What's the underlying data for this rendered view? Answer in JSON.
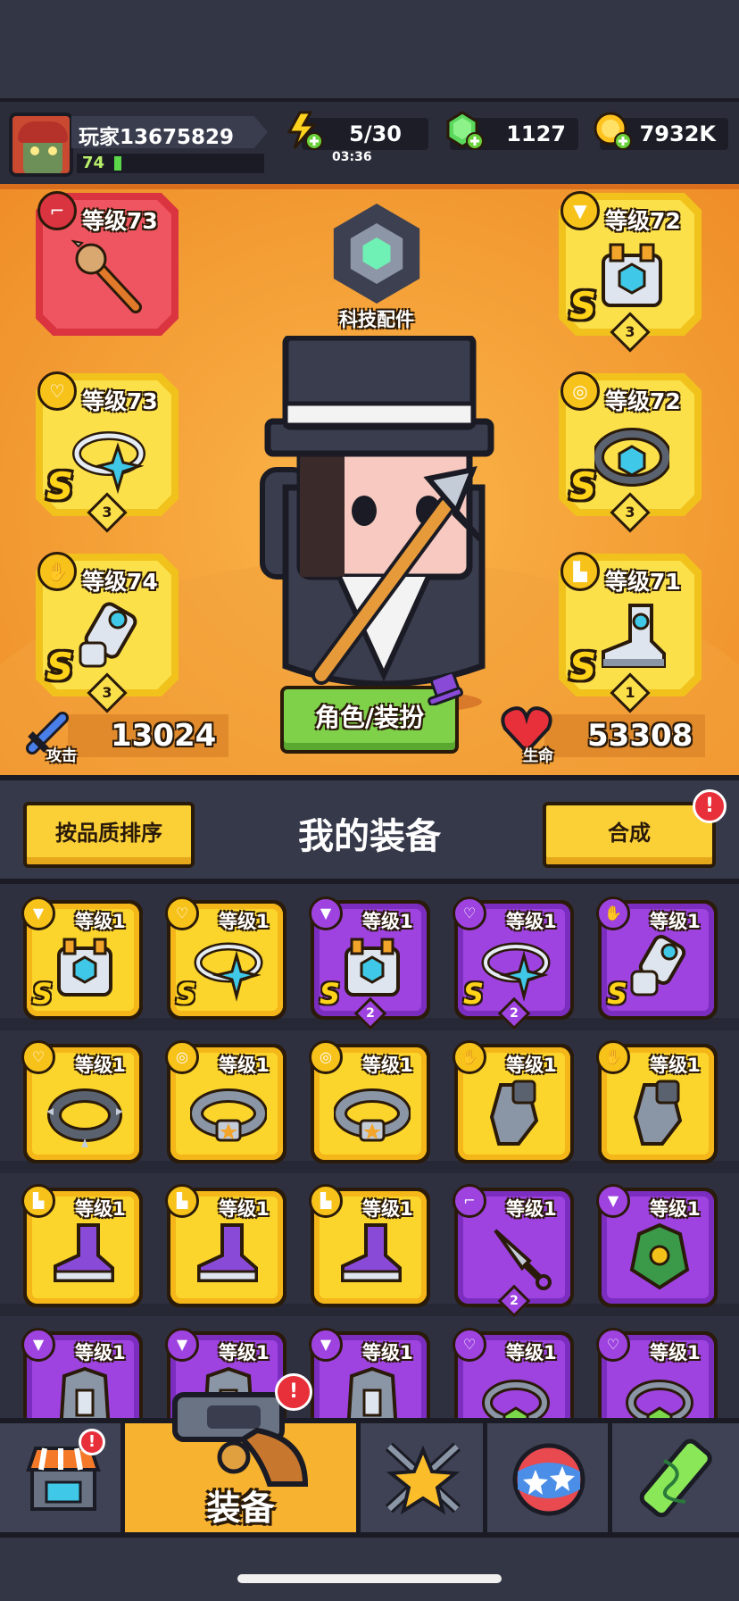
{
  "player": {
    "name": "玩家13675829",
    "level": "74",
    "xp_fraction": 0.05
  },
  "resources": {
    "energy": "5/30",
    "energy_timer": "03:36",
    "gems": "1127",
    "coins": "7932K"
  },
  "tech": {
    "label": "科技配件"
  },
  "equipped": {
    "weapon": {
      "level": "等级73",
      "slot_icon": "gun-icon",
      "item": "spiked-club"
    },
    "armor": {
      "level": "等级72",
      "slot_icon": "shirt-icon",
      "grade": "S",
      "stars": "3",
      "item": "mech-armor"
    },
    "necklace": {
      "level": "等级73",
      "slot_icon": "necklace-icon",
      "grade": "S",
      "stars": "3",
      "item": "star-ring"
    },
    "belt": {
      "level": "等级72",
      "slot_icon": "belt-icon",
      "grade": "S",
      "stars": "3",
      "item": "hex-belt"
    },
    "gloves": {
      "level": "等级74",
      "slot_icon": "glove-icon",
      "grade": "S",
      "stars": "3",
      "item": "mech-gauntlet"
    },
    "boots": {
      "level": "等级71",
      "slot_icon": "boot-icon",
      "grade": "S",
      "stars": "1",
      "item": "mech-boot"
    }
  },
  "stats": {
    "attack_label": "攻击",
    "attack": "13024",
    "hp_label": "生命",
    "hp": "53308"
  },
  "role_button": "角色/装扮",
  "section": {
    "sort_button": "按品质排序",
    "title": "我的装备",
    "merge_button": "合成",
    "merge_alert": "!"
  },
  "inventory": [
    {
      "level": "等级1",
      "rarity": "yellow",
      "grade": "S",
      "stars": "",
      "slot_icon": "shirt-icon",
      "item": "mech-armor"
    },
    {
      "level": "等级1",
      "rarity": "yellow",
      "grade": "S",
      "stars": "",
      "slot_icon": "necklace-icon",
      "item": "star-ring"
    },
    {
      "level": "等级1",
      "rarity": "purple",
      "grade": "S",
      "stars": "2",
      "slot_icon": "shirt-icon",
      "item": "mech-armor"
    },
    {
      "level": "等级1",
      "rarity": "purple",
      "grade": "S",
      "stars": "2",
      "slot_icon": "necklace-icon",
      "item": "star-ring"
    },
    {
      "level": "等级1",
      "rarity": "purple",
      "grade": "S",
      "stars": "",
      "slot_icon": "glove-icon",
      "item": "mech-gauntlet"
    },
    {
      "level": "等级1",
      "rarity": "yellow",
      "grade": "",
      "stars": "",
      "slot_icon": "necklace-icon",
      "item": "spiked-collar"
    },
    {
      "level": "等级1",
      "rarity": "yellow",
      "grade": "",
      "stars": "",
      "slot_icon": "belt-icon",
      "item": "star-belt"
    },
    {
      "level": "等级1",
      "rarity": "yellow",
      "grade": "",
      "stars": "",
      "slot_icon": "belt-icon",
      "item": "star-belt"
    },
    {
      "level": "等级1",
      "rarity": "yellow",
      "grade": "",
      "stars": "",
      "slot_icon": "glove-icon",
      "item": "steel-gauntlet"
    },
    {
      "level": "等级1",
      "rarity": "yellow",
      "grade": "",
      "stars": "",
      "slot_icon": "glove-icon",
      "item": "steel-gauntlet"
    },
    {
      "level": "等级1",
      "rarity": "yellow",
      "grade": "",
      "stars": "",
      "slot_icon": "boot-icon",
      "item": "sneaker"
    },
    {
      "level": "等级1",
      "rarity": "yellow",
      "grade": "",
      "stars": "",
      "slot_icon": "boot-icon",
      "item": "sneaker"
    },
    {
      "level": "等级1",
      "rarity": "yellow",
      "grade": "",
      "stars": "",
      "slot_icon": "boot-icon",
      "item": "sneaker"
    },
    {
      "level": "等级1",
      "rarity": "purple",
      "grade": "",
      "stars": "2",
      "slot_icon": "gun-icon",
      "item": "kunai"
    },
    {
      "level": "等级1",
      "rarity": "purple",
      "grade": "",
      "stars": "",
      "slot_icon": "shirt-icon",
      "item": "leaf-vest"
    },
    {
      "level": "等级1",
      "rarity": "purple",
      "grade": "",
      "stars": "",
      "slot_icon": "shirt-icon",
      "item": "vest"
    },
    {
      "level": "等级1",
      "rarity": "purple",
      "grade": "",
      "stars": "",
      "slot_icon": "shirt-icon",
      "item": "vest"
    },
    {
      "level": "等级1",
      "rarity": "purple",
      "grade": "",
      "stars": "",
      "slot_icon": "shirt-icon",
      "item": "vest"
    },
    {
      "level": "等级1",
      "rarity": "purple",
      "grade": "",
      "stars": "",
      "slot_icon": "necklace-icon",
      "item": "gem-ring"
    },
    {
      "level": "等级1",
      "rarity": "purple",
      "grade": "",
      "stars": "",
      "slot_icon": "necklace-icon",
      "item": "gem-ring"
    }
  ],
  "tabs": [
    {
      "id": "shop",
      "label": "",
      "icon": "shop-icon",
      "alert": "!"
    },
    {
      "id": "equipment",
      "label": "装备",
      "icon": "revolver-icon",
      "alert": "!",
      "active": true
    },
    {
      "id": "talent",
      "label": "",
      "icon": "star-swords-icon"
    },
    {
      "id": "skills",
      "label": "",
      "icon": "orb-icon"
    },
    {
      "id": "evolve",
      "label": "",
      "icon": "dna-tube-icon"
    }
  ],
  "colors": {
    "hero_bg": "#f5a33a",
    "rare_yellow": "#fbd52c",
    "epic_purple": "#9e43e0",
    "active_tab": "#f7b22f"
  }
}
